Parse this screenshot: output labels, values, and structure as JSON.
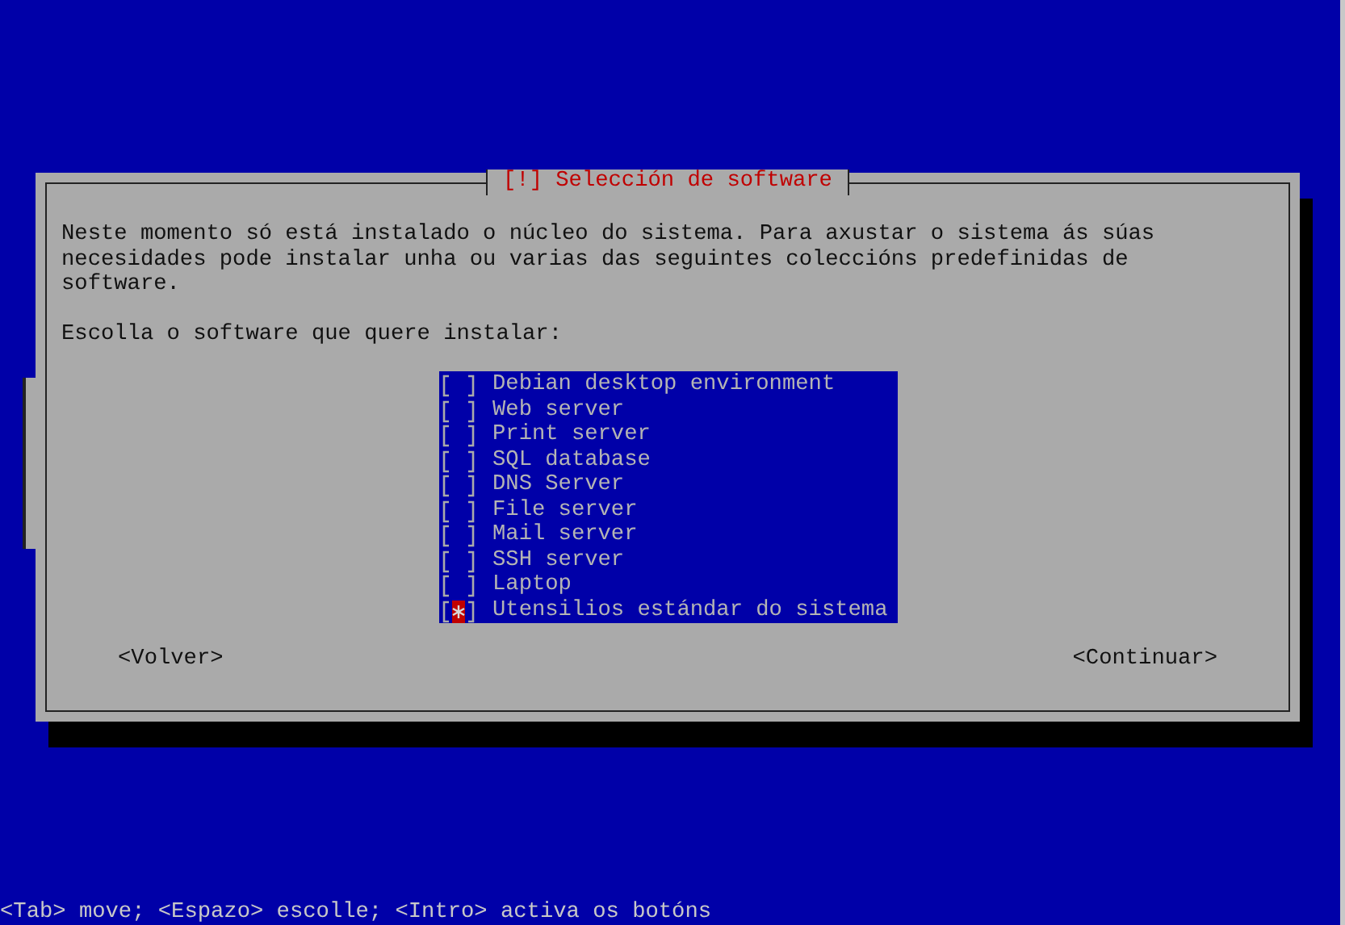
{
  "dialog": {
    "title": "[!] Selección de software",
    "description": "Neste momento só está instalado o núcleo do sistema. Para axustar o sistema ás súas\nnecesidades pode instalar unha ou varias das seguintes coleccións predefinidas de\nsoftware.",
    "prompt": "Escolla o software que quere instalar:",
    "items": [
      {
        "label": "Debian desktop environment",
        "checked": false,
        "focused": false
      },
      {
        "label": "Web server",
        "checked": false,
        "focused": false
      },
      {
        "label": "Print server",
        "checked": false,
        "focused": false
      },
      {
        "label": "SQL database",
        "checked": false,
        "focused": false
      },
      {
        "label": "DNS Server",
        "checked": false,
        "focused": false
      },
      {
        "label": "File server",
        "checked": false,
        "focused": false
      },
      {
        "label": "Mail server",
        "checked": false,
        "focused": false
      },
      {
        "label": "SSH server",
        "checked": false,
        "focused": false
      },
      {
        "label": "Laptop",
        "checked": false,
        "focused": false
      },
      {
        "label": "Utensilios estándar do sistema",
        "checked": true,
        "focused": true
      }
    ],
    "buttons": [
      "<Volver>",
      "<Continuar>"
    ]
  },
  "status_bar": "<Tab> move; <Espazo> escolle; <Intro> activa os botóns"
}
